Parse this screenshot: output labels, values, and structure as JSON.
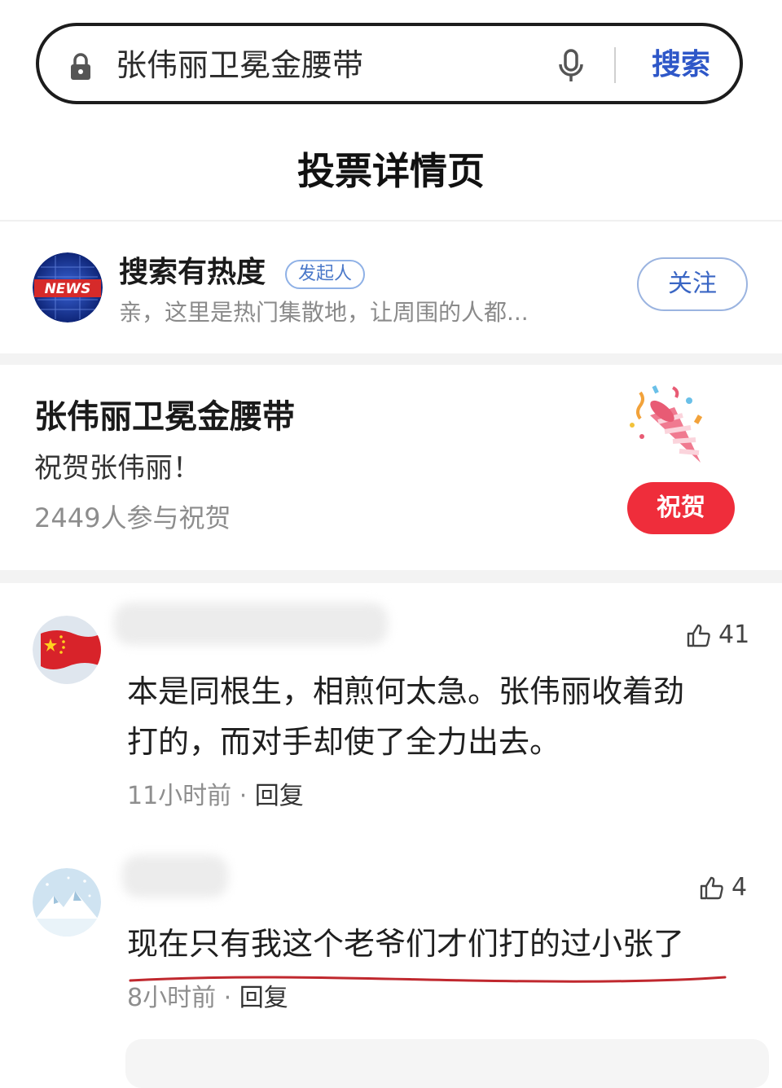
{
  "search": {
    "query": "张伟丽卫冕金腰带",
    "button_label": "搜索"
  },
  "page": {
    "title": "投票详情页"
  },
  "publisher": {
    "name": "搜索有热度",
    "badge": "发起人",
    "description": "亲，这里是热门集散地，让周围的人都...",
    "avatar_text": "NEWS",
    "follow_label": "关注"
  },
  "vote": {
    "title": "张伟丽卫冕金腰带",
    "subtitle": "祝贺张伟丽！",
    "participants": "2449人参与祝贺",
    "button_label": "祝贺"
  },
  "comments": [
    {
      "likes": "41",
      "text_line1": "本是同根生，相煎何太急。张伟丽收着劲",
      "text_line2": "打的，而对手却使了全力出去。",
      "time": "11小时前",
      "reply_label": "回复"
    },
    {
      "likes": "4",
      "text_line1": "现在只有我这个老爷们才们打的过小张了",
      "time": "8小时前",
      "reply_label": "回复"
    }
  ],
  "meta_separator": " · ",
  "colors": {
    "accent_blue": "#2e57c8",
    "congrats_red": "#ef2d3b",
    "underline_red": "#c0282e"
  }
}
